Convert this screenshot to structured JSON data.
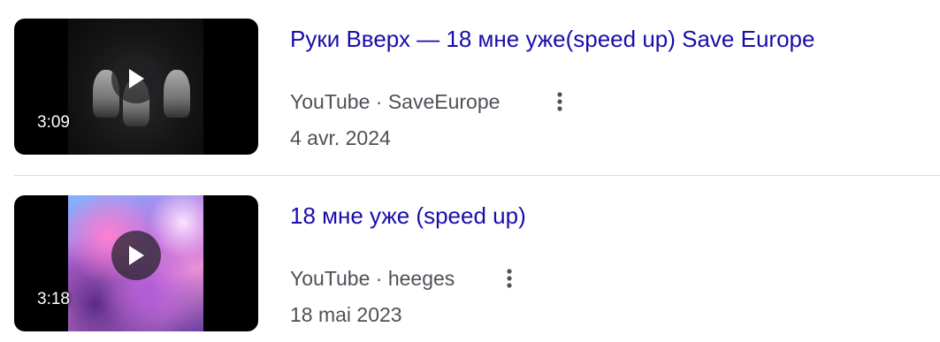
{
  "results": [
    {
      "title": "Руки Вверх — 18 мне уже(speed up) Save Europe",
      "duration": "3:09",
      "source": "YouTube",
      "separator": "·",
      "channel": "SaveEurope",
      "date": "4 avr. 2024"
    },
    {
      "title": "18 мне уже (speed up)",
      "duration": "3:18",
      "source": "YouTube",
      "separator": "·",
      "channel": "heeges",
      "date": "18 mai 2023"
    }
  ],
  "icons": {
    "play": "play-icon",
    "more": "more-vert-icon"
  },
  "colors": {
    "title_link": "#1a0dab",
    "meta_text": "#4d5156",
    "divider": "#dadce0",
    "overlay": "#202124"
  }
}
